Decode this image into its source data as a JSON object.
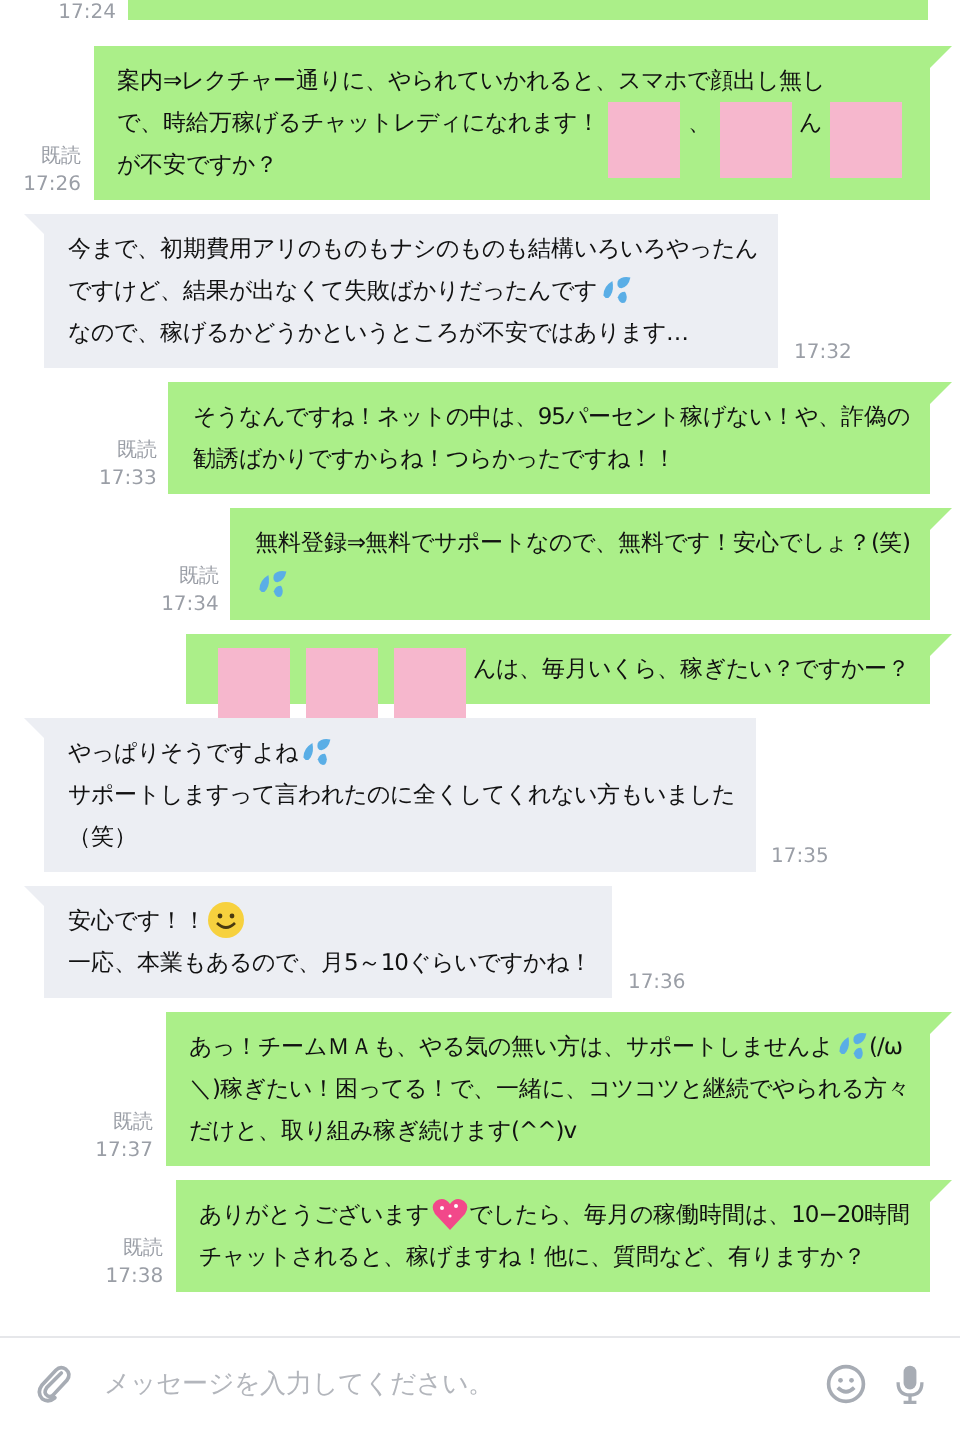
{
  "top_partial": {
    "time": "17:24"
  },
  "messages": [
    {
      "kind": "sent",
      "read": "既読",
      "time": "17:26",
      "lines": [
        [
          {
            "kind": "text",
            "text": "案内⇒レクチャー通りに、やられていかれると、スマホで顔出し無し"
          }
        ],
        [
          {
            "kind": "text",
            "text": "で、時給万稼げるチャットレディになれます！"
          },
          {
            "kind": "redaction"
          },
          {
            "kind": "text",
            "text": "、"
          },
          {
            "kind": "redaction"
          },
          {
            "kind": "text",
            "text": "ん"
          },
          {
            "kind": "redaction"
          }
        ],
        [
          {
            "kind": "text",
            "text": "が不安ですか？"
          }
        ]
      ]
    },
    {
      "kind": "received",
      "time": "17:32",
      "lines": [
        [
          {
            "kind": "text",
            "text": "今まで、初期費用アリのものもナシのものも結構いろいろやったん"
          }
        ],
        [
          {
            "kind": "text",
            "text": "ですけど、結果が出なくて失敗ばかりだったんです"
          },
          {
            "kind": "sweat"
          }
        ],
        [
          {
            "kind": "text",
            "text": "なので、稼げるかどうかというところが不安ではあります…"
          }
        ]
      ]
    },
    {
      "kind": "sent",
      "read": "既読",
      "time": "17:33",
      "lines": [
        [
          {
            "kind": "text",
            "text": "そうなんですね！ネットの中は、95パーセント稼げない！や、詐偽の"
          }
        ],
        [
          {
            "kind": "text",
            "text": "勧誘ばかりですからね！つらかったですね！！"
          }
        ]
      ]
    },
    {
      "kind": "sent",
      "read": "既読",
      "time": "17:34",
      "lines": [
        [
          {
            "kind": "text",
            "text": "無料登録⇒無料でサポートなので、無料です！安心でしょ？(笑)"
          }
        ],
        [
          {
            "kind": "sweat"
          }
        ]
      ]
    },
    {
      "kind": "sent",
      "lines": [
        [
          {
            "kind": "redaction"
          },
          {
            "kind": "redaction"
          },
          {
            "kind": "redaction"
          },
          {
            "kind": "text",
            "text": "んは、毎月いくら、稼ぎたい？ですかー？"
          }
        ]
      ]
    },
    {
      "kind": "received",
      "time": "17:35",
      "lines": [
        [
          {
            "kind": "text",
            "text": "やっぱりそうですよね"
          },
          {
            "kind": "sweat"
          }
        ],
        [
          {
            "kind": "text",
            "text": "サポートしますって言われたのに全くしてくれない方もいました"
          }
        ],
        [
          {
            "kind": "text",
            "text": "（笑）"
          }
        ]
      ]
    },
    {
      "kind": "received",
      "time": "17:36",
      "lines": [
        [
          {
            "kind": "text",
            "text": "安心です！！"
          },
          {
            "kind": "smiley"
          }
        ],
        [
          {
            "kind": "text",
            "text": "一応、本業もあるので、月5～10ぐらいですかね！"
          }
        ]
      ]
    },
    {
      "kind": "sent",
      "read": "既読",
      "time": "17:37",
      "lines": [
        [
          {
            "kind": "text",
            "text": "あっ！チームＭＡも、やる気の無い方は、サポートしませんよ"
          },
          {
            "kind": "sweat"
          },
          {
            "kind": "text",
            "text": "(/ω"
          }
        ],
        [
          {
            "kind": "text",
            "text": "＼)稼ぎたい！困ってる！で、一緒に、コツコツと継続でやられる方々"
          }
        ],
        [
          {
            "kind": "text",
            "text": "だけと、取り組み稼ぎ続けます(^^)v"
          }
        ]
      ]
    },
    {
      "kind": "sent",
      "read": "既読",
      "time": "17:38",
      "lines": [
        [
          {
            "kind": "text",
            "text": "ありがとうございます"
          },
          {
            "kind": "heart"
          },
          {
            "kind": "text",
            "text": "でしたら、毎月の稼働時間は、10−20時間"
          }
        ],
        [
          {
            "kind": "text",
            "text": "チャットされると、稼げますね！他に、質問など、有りますか？"
          }
        ]
      ]
    }
  ],
  "input": {
    "placeholder": "メッセージを入力してください。"
  }
}
